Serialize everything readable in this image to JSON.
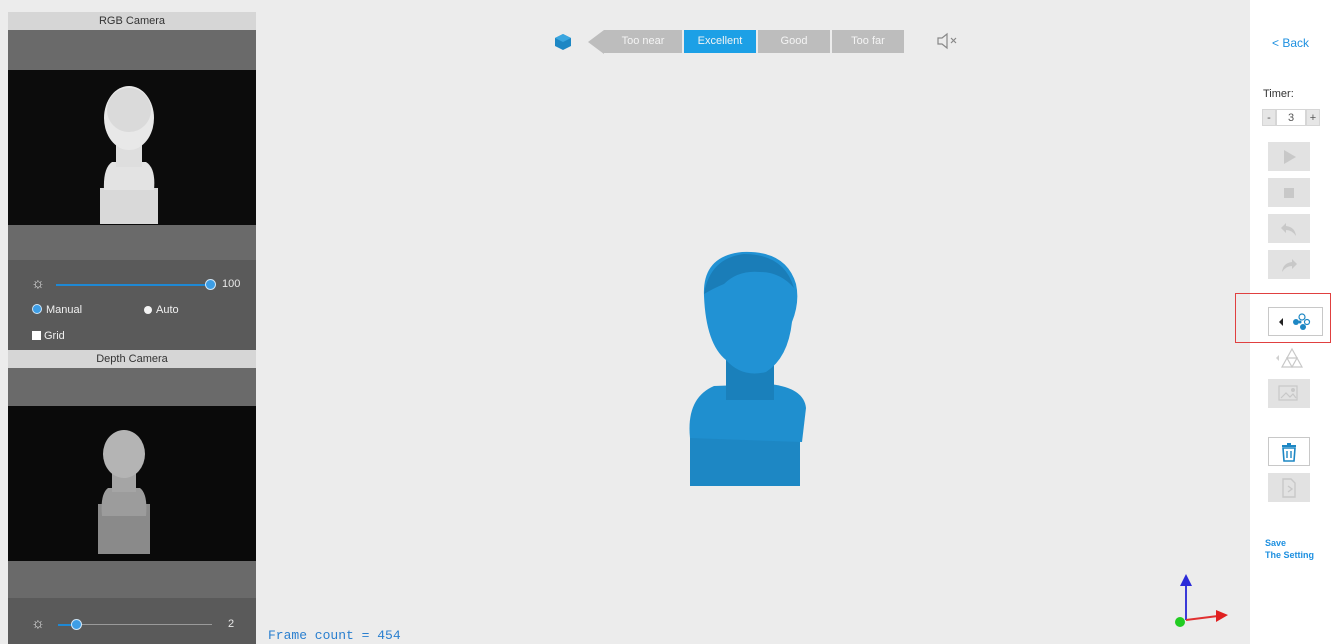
{
  "rgb_camera": {
    "title": "RGB Camera",
    "brightness_value": "100",
    "brightness_level": 1.0,
    "mode_manual": "Manual",
    "mode_auto": "Auto",
    "grid_label": "Grid"
  },
  "depth_camera": {
    "title": "Depth Camera",
    "value": "2",
    "level": 0.1
  },
  "quality_bar": {
    "items": [
      "Too near",
      "Excellent",
      "Good",
      "Too far"
    ],
    "active": "Excellent"
  },
  "status": {
    "frame_count": "Frame count = 454"
  },
  "sidebar": {
    "back_label": "< Back",
    "timer_label": "Timer:",
    "timer_minus": "-",
    "timer_value": "3",
    "timer_plus": "+",
    "save_line1": "Save",
    "save_line2": "The Setting"
  },
  "colors": {
    "accent": "#1ca0e6",
    "model": "#1d87c4",
    "highlight": "#e04040"
  }
}
